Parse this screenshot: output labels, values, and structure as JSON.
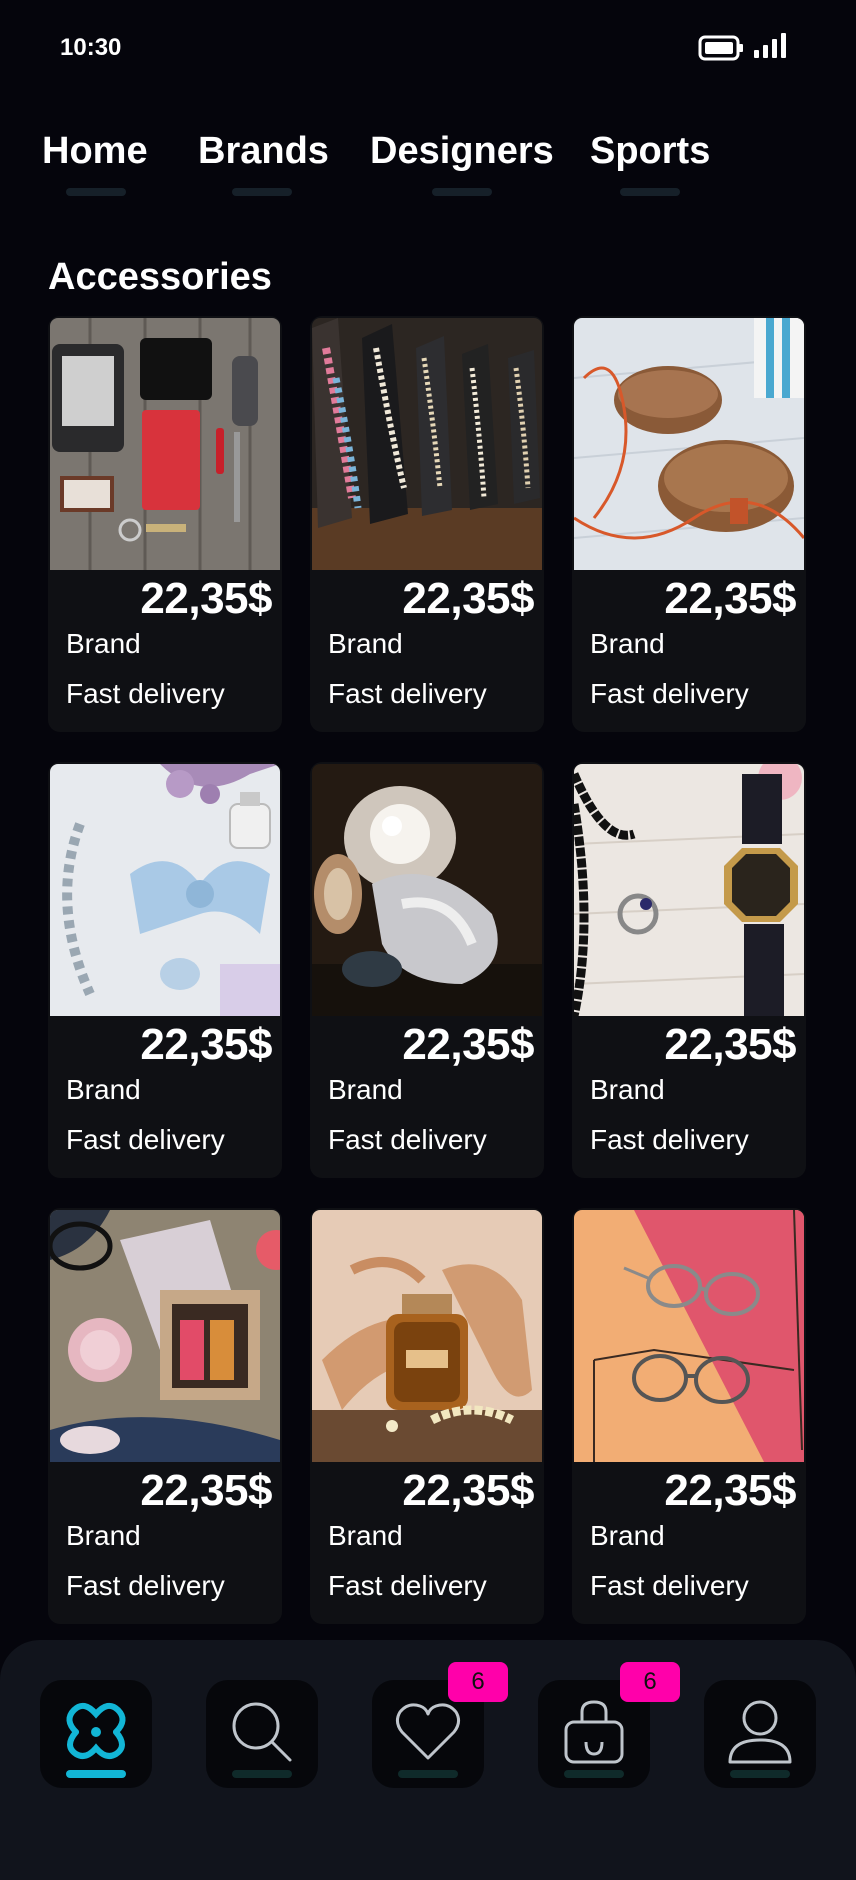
{
  "status": {
    "time": "10:30"
  },
  "nav": {
    "tabs": [
      {
        "label": "Home"
      },
      {
        "label": "Brands"
      },
      {
        "label": "Designers"
      },
      {
        "label": "Sports"
      }
    ]
  },
  "section": {
    "title": "Accessories"
  },
  "products": [
    {
      "price": "22,35$",
      "brand": "Brand",
      "delivery": "Fast delivery",
      "image": "flat-lay of wallet, e-reader, phone and keys"
    },
    {
      "price": "22,35$",
      "brand": "Brand",
      "delivery": "Fast delivery",
      "image": "necklaces on wooden stands"
    },
    {
      "price": "22,35$",
      "brand": "Brand",
      "delivery": "Fast delivery",
      "image": "round rattan bags"
    },
    {
      "price": "22,35$",
      "brand": "Brand",
      "delivery": "Fast delivery",
      "image": "blue bow, perfume and bracelets"
    },
    {
      "price": "22,35$",
      "brand": "Brand",
      "delivery": "Fast delivery",
      "image": "pearl diamond ring"
    },
    {
      "price": "22,35$",
      "brand": "Brand",
      "delivery": "Fast delivery",
      "image": "octagon wristwatch and beads"
    },
    {
      "price": "22,35$",
      "brand": "Brand",
      "delivery": "Fast delivery",
      "image": "gift box with glasses"
    },
    {
      "price": "22,35$",
      "brand": "Brand",
      "delivery": "Fast delivery",
      "image": "perfume bottle with sandals"
    },
    {
      "price": "22,35$",
      "brand": "Brand",
      "delivery": "Fast delivery",
      "image": "two pairs of eyeglasses"
    }
  ],
  "bottom_bar": {
    "items": [
      {
        "icon": "logo-icon",
        "active": true
      },
      {
        "icon": "search-icon"
      },
      {
        "icon": "heart-icon",
        "badge": "6"
      },
      {
        "icon": "shopping-bag-icon",
        "badge": "6"
      },
      {
        "icon": "profile-icon"
      }
    ]
  },
  "colors": {
    "background": "#05050c",
    "card": "#0f1014",
    "accent": "#12b6d6",
    "badge": "#ff00aa"
  }
}
